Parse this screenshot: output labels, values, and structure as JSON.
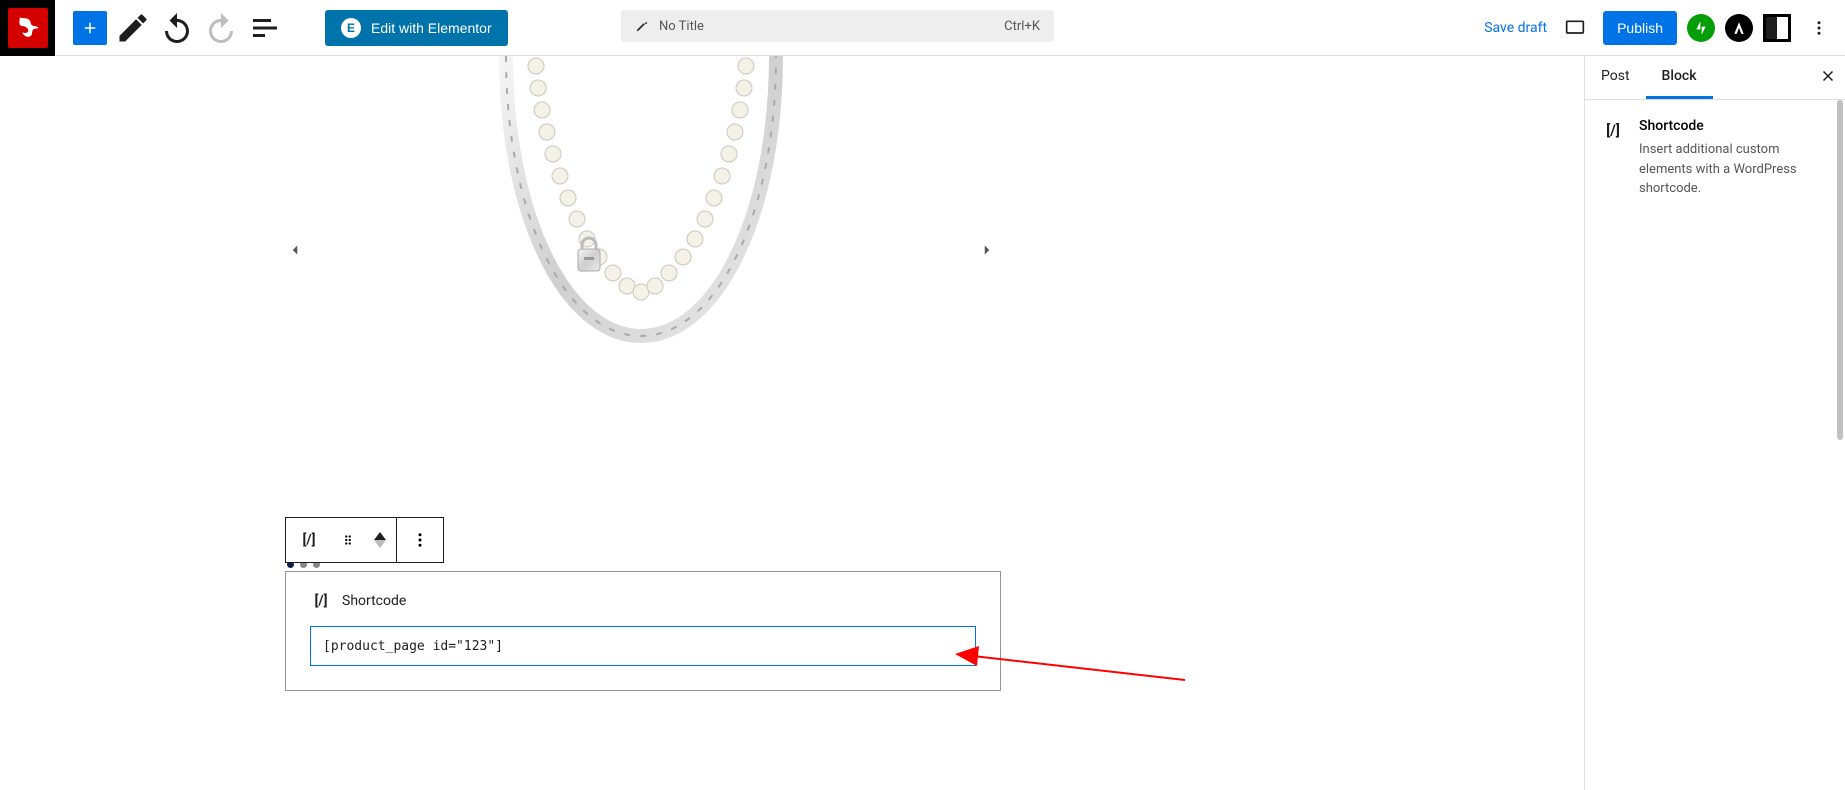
{
  "toolbar": {
    "elementor_label": "Edit with Elementor",
    "title_placeholder": "No Title",
    "title_shortcut": "Ctrl+K",
    "save_draft_label": "Save draft",
    "publish_label": "Publish"
  },
  "sidebar": {
    "tabs": {
      "post": "Post",
      "block": "Block"
    },
    "block_title": "Shortcode",
    "block_desc": "Insert additional custom elements with a WordPress shortcode."
  },
  "canvas": {
    "shortcode_label": "Shortcode",
    "shortcode_value": "[product_page id=\"123\"]"
  },
  "icons": {
    "shortcode_glyph": "[/]"
  }
}
